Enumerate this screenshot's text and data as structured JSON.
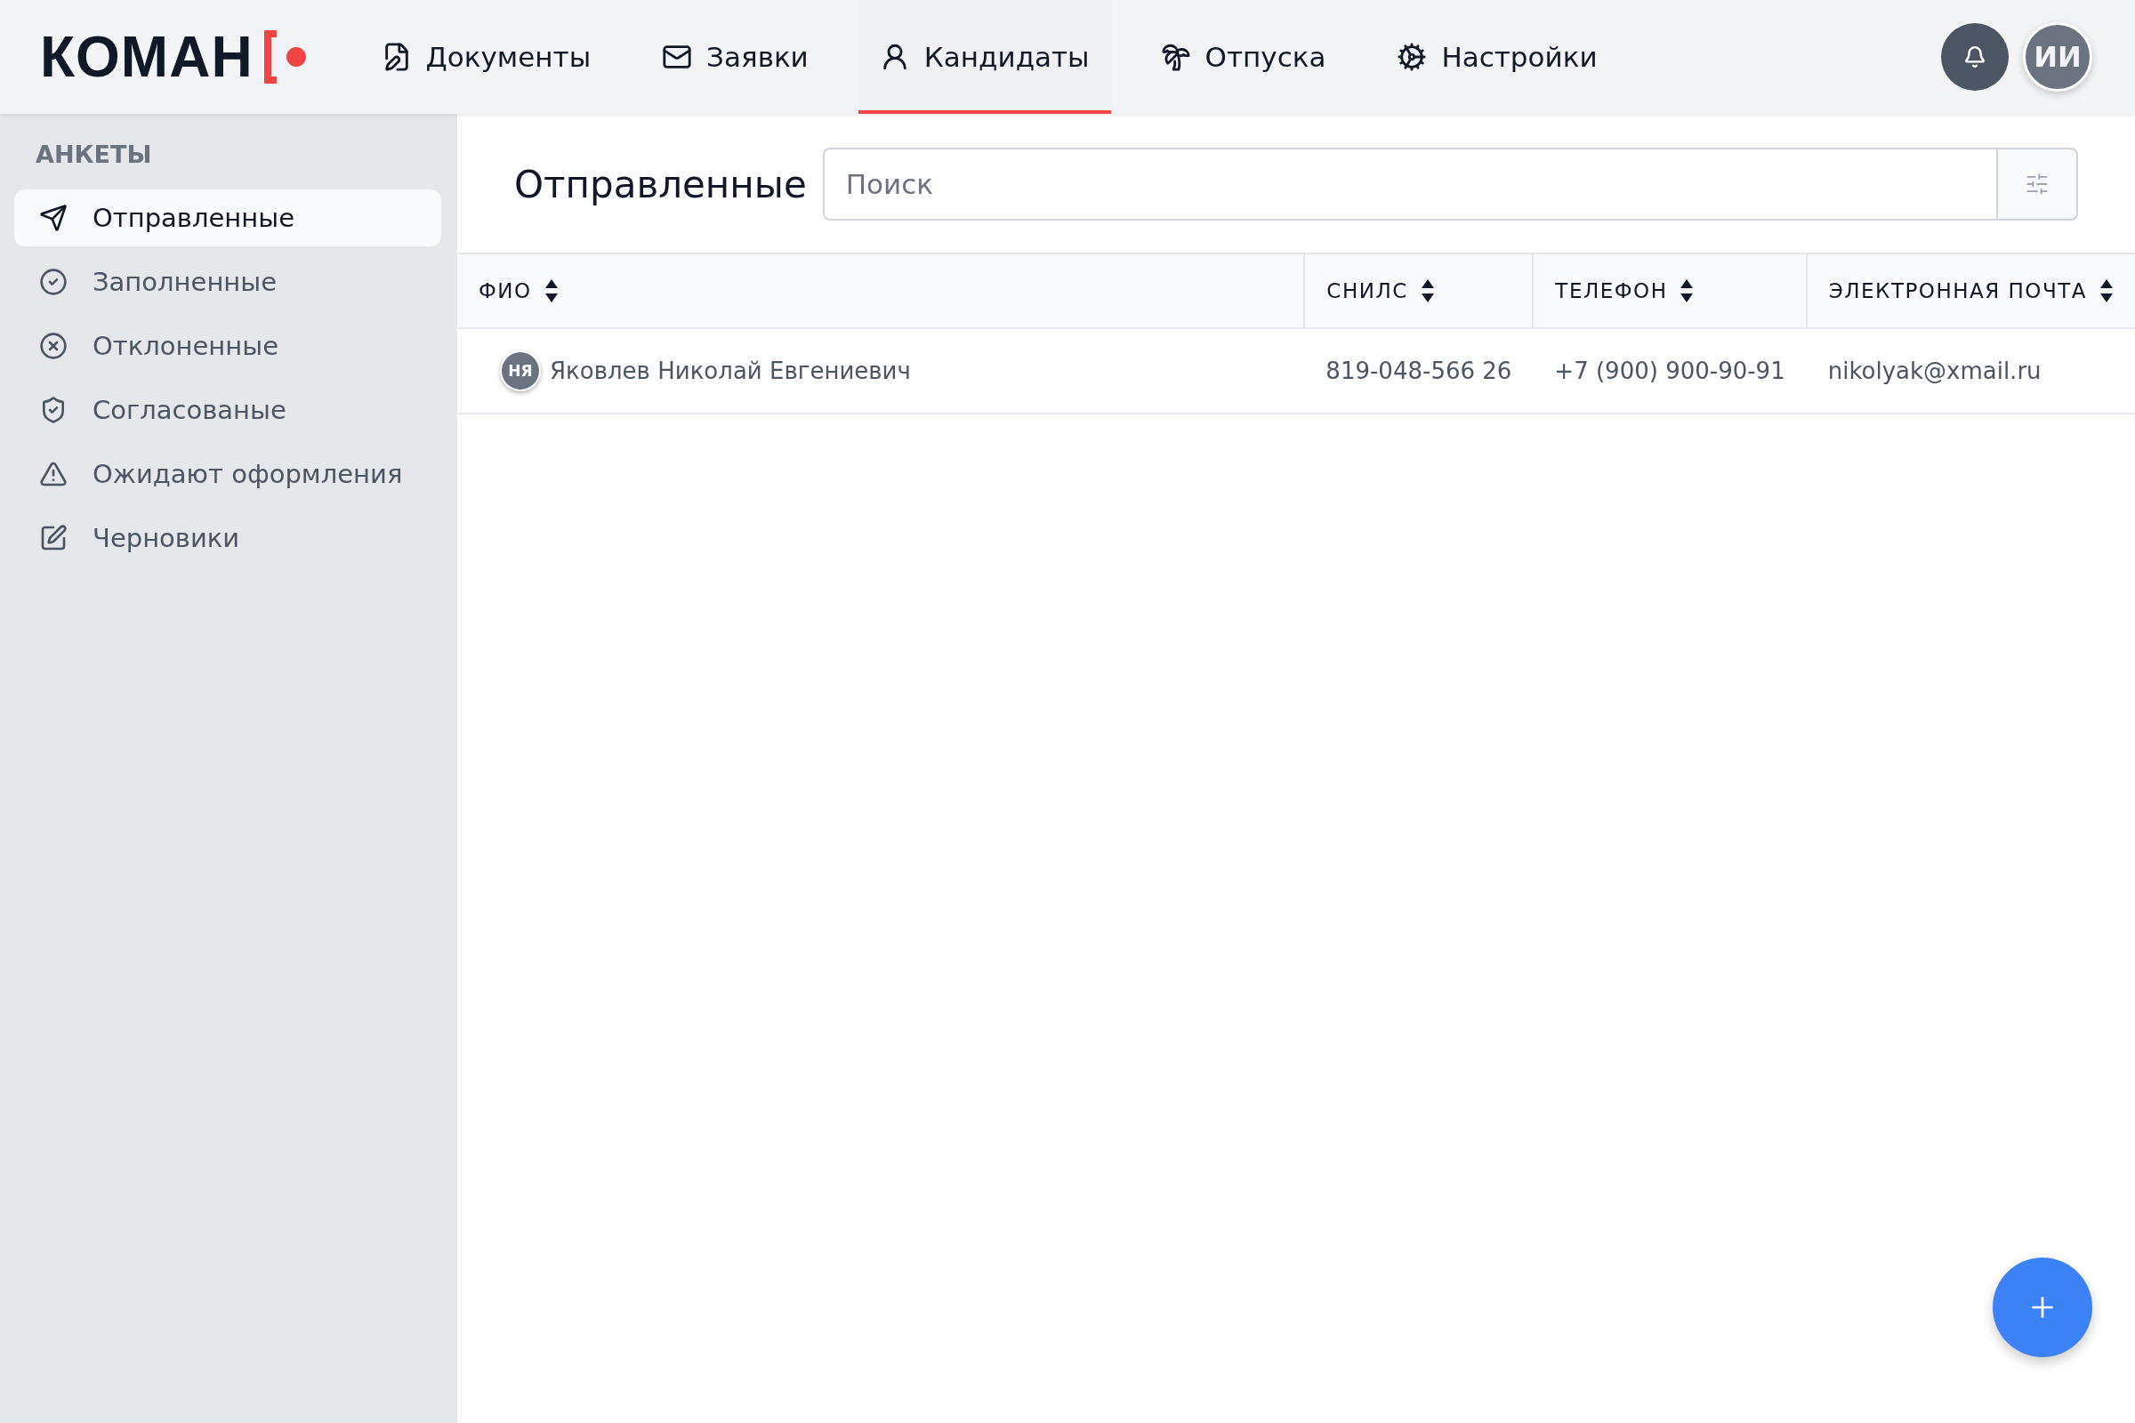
{
  "logo": {
    "text": "КОМАН"
  },
  "nav": [
    {
      "label": "Документы",
      "selected": false
    },
    {
      "label": "Заявки",
      "selected": false
    },
    {
      "label": "Кандидаты",
      "selected": true
    },
    {
      "label": "Отпуска",
      "selected": false
    },
    {
      "label": "Настройки",
      "selected": false
    }
  ],
  "user": {
    "initials": "ИИ"
  },
  "sidebar": {
    "title": "АНКЕТЫ",
    "items": [
      {
        "label": "Отправленные",
        "selected": true
      },
      {
        "label": "Заполненные",
        "selected": false
      },
      {
        "label": "Отклоненные",
        "selected": false
      },
      {
        "label": "Согласованые",
        "selected": false
      },
      {
        "label": "Ожидают оформления",
        "selected": false
      },
      {
        "label": "Черновики",
        "selected": false
      }
    ]
  },
  "page": {
    "title": "Отправленные",
    "search": {
      "placeholder": "Поиск"
    }
  },
  "table": {
    "columns": [
      "ФИО",
      "СНИЛС",
      "ТЕЛЕФОН",
      "ЭЛЕКТРОННАЯ ПОЧТА"
    ],
    "rows": [
      {
        "initials": "НЯ",
        "name": "Яковлев Николай Евгениевич",
        "snils": "819-048-566 26",
        "phone": "+7 (900) 900-90-91",
        "email": "nikolyak@xmail.ru"
      }
    ]
  }
}
